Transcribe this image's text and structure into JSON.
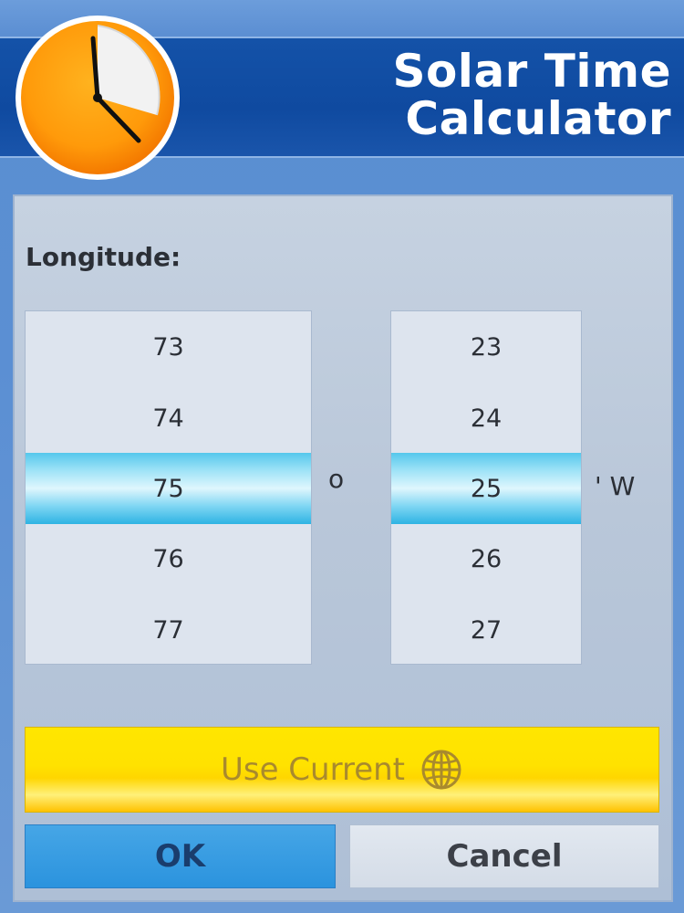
{
  "app": {
    "title_line1": "Solar Time",
    "title_line2": "Calculator"
  },
  "form": {
    "longitude_label": "Longitude:",
    "degrees": {
      "values": [
        "73",
        "74",
        "75",
        "76",
        "77"
      ],
      "selected": "75",
      "unit": "o"
    },
    "minutes": {
      "values": [
        "23",
        "24",
        "25",
        "26",
        "27"
      ],
      "selected": "25",
      "unit": "' W"
    }
  },
  "buttons": {
    "use_current_label": "Use Current",
    "ok_label": "OK",
    "cancel_label": "Cancel"
  },
  "icons": {
    "app": "clock-icon",
    "use_current": "globe-icon"
  },
  "colors": {
    "header": "#0f4aa0",
    "clock_face": "#ff9800",
    "selection": "#55c7ec",
    "use_current_button": "#ffe200",
    "ok_button": "#2b93de",
    "cancel_button": "#d4dce7"
  }
}
